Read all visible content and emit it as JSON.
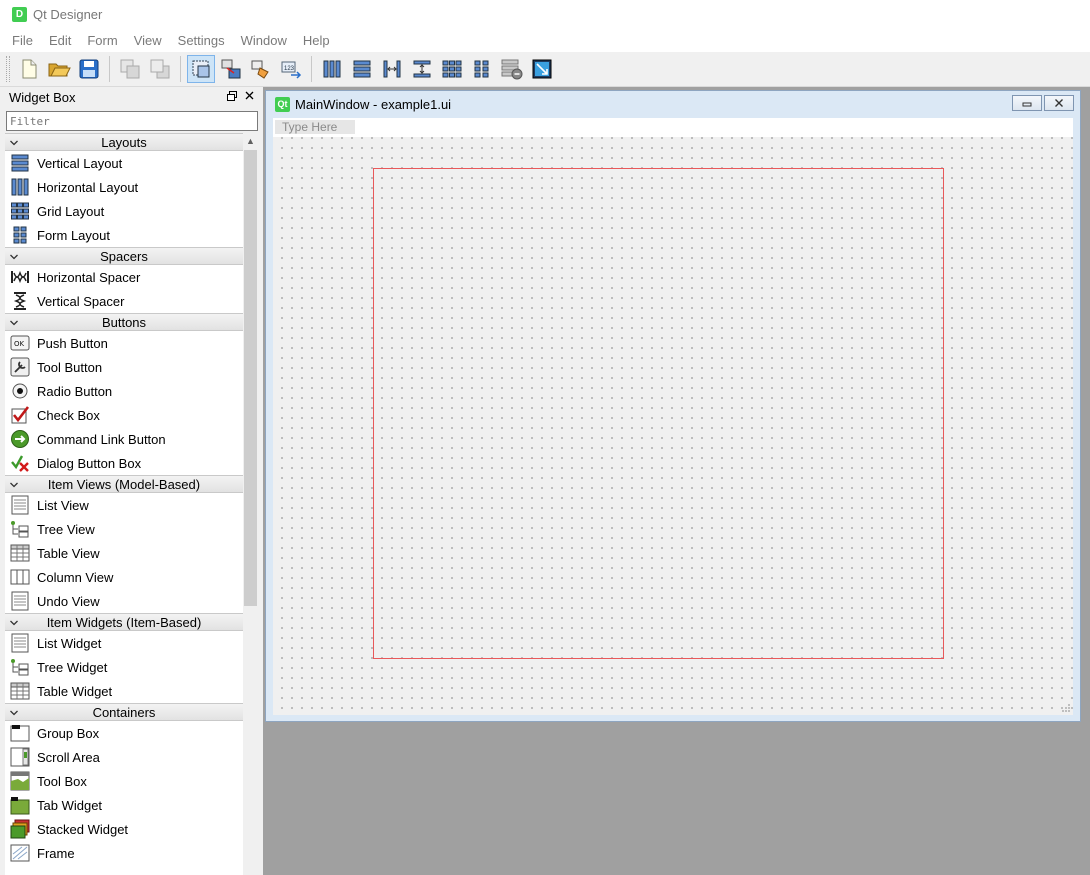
{
  "app": {
    "icon_letter": "D",
    "title": "Qt Designer"
  },
  "menu": [
    "File",
    "Edit",
    "Form",
    "View",
    "Settings",
    "Window",
    "Help"
  ],
  "toolbar": [
    {
      "name": "new-form-icon"
    },
    {
      "name": "open-form-icon"
    },
    {
      "name": "save-form-icon"
    },
    {
      "sep": true
    },
    {
      "name": "send-to-back-icon"
    },
    {
      "name": "bring-to-front-icon"
    },
    {
      "sep": true
    },
    {
      "name": "edit-widgets-icon",
      "active": true
    },
    {
      "name": "edit-signals-slots-icon"
    },
    {
      "name": "edit-buddies-icon"
    },
    {
      "name": "edit-tab-order-icon"
    },
    {
      "sep": true
    },
    {
      "name": "lay-out-horizontally-icon"
    },
    {
      "name": "lay-out-vertically-icon"
    },
    {
      "name": "splitter-horizontal-icon"
    },
    {
      "name": "splitter-vertical-icon"
    },
    {
      "name": "lay-out-grid-icon"
    },
    {
      "name": "lay-out-form-icon"
    },
    {
      "name": "break-layout-icon"
    },
    {
      "name": "adjust-size-icon"
    }
  ],
  "widget_box": {
    "title": "Widget Box",
    "filter_placeholder": "Filter",
    "categories": [
      {
        "label": "Layouts",
        "items": [
          {
            "label": "Vertical Layout",
            "icon": "vertical-layout-icon"
          },
          {
            "label": "Horizontal Layout",
            "icon": "horizontal-layout-icon"
          },
          {
            "label": "Grid Layout",
            "icon": "grid-layout-icon"
          },
          {
            "label": "Form Layout",
            "icon": "form-layout-icon"
          }
        ]
      },
      {
        "label": "Spacers",
        "items": [
          {
            "label": "Horizontal Spacer",
            "icon": "horizontal-spacer-icon"
          },
          {
            "label": "Vertical Spacer",
            "icon": "vertical-spacer-icon"
          }
        ]
      },
      {
        "label": "Buttons",
        "items": [
          {
            "label": "Push Button",
            "icon": "push-button-icon"
          },
          {
            "label": "Tool Button",
            "icon": "tool-button-icon"
          },
          {
            "label": "Radio Button",
            "icon": "radio-button-icon"
          },
          {
            "label": "Check Box",
            "icon": "check-box-icon"
          },
          {
            "label": "Command Link Button",
            "icon": "command-link-icon"
          },
          {
            "label": "Dialog Button Box",
            "icon": "dialog-button-box-icon"
          }
        ]
      },
      {
        "label": "Item Views (Model-Based)",
        "items": [
          {
            "label": "List View",
            "icon": "list-view-icon"
          },
          {
            "label": "Tree View",
            "icon": "tree-view-icon"
          },
          {
            "label": "Table View",
            "icon": "table-view-icon"
          },
          {
            "label": "Column View",
            "icon": "column-view-icon"
          },
          {
            "label": "Undo View",
            "icon": "undo-view-icon"
          }
        ]
      },
      {
        "label": "Item Widgets (Item-Based)",
        "items": [
          {
            "label": "List Widget",
            "icon": "list-widget-icon"
          },
          {
            "label": "Tree Widget",
            "icon": "tree-widget-icon"
          },
          {
            "label": "Table Widget",
            "icon": "table-widget-icon"
          }
        ]
      },
      {
        "label": "Containers",
        "items": [
          {
            "label": "Group Box",
            "icon": "group-box-icon"
          },
          {
            "label": "Scroll Area",
            "icon": "scroll-area-icon"
          },
          {
            "label": "Tool Box",
            "icon": "tool-box-icon"
          },
          {
            "label": "Tab Widget",
            "icon": "tab-widget-icon"
          },
          {
            "label": "Stacked Widget",
            "icon": "stacked-widget-icon"
          },
          {
            "label": "Frame",
            "icon": "frame-icon"
          }
        ]
      }
    ]
  },
  "form_window": {
    "badge": "Qt",
    "title": "MainWindow - example1.ui",
    "menubar_placeholder": "Type Here"
  }
}
